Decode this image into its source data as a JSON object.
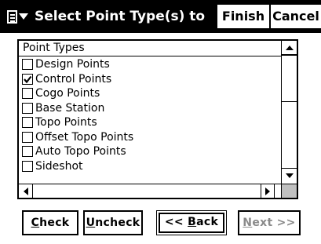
{
  "window": {
    "title": "Select Point Type(s) to Exp",
    "menu_icon": "document-menu-icon"
  },
  "titlebar_buttons": {
    "finish": "Finish",
    "cancel": "Cancel"
  },
  "list": {
    "header": "Point Types",
    "items": [
      {
        "label": "Design Points",
        "checked": false
      },
      {
        "label": "Control Points",
        "checked": true
      },
      {
        "label": "Cogo Points",
        "checked": false
      },
      {
        "label": "Base Station",
        "checked": false
      },
      {
        "label": "Topo Points",
        "checked": false
      },
      {
        "label": "Offset Topo Points",
        "checked": false
      },
      {
        "label": "Auto Topo Points",
        "checked": false
      },
      {
        "label": "Sideshot",
        "checked": false
      }
    ]
  },
  "buttons": {
    "check": {
      "mnemonic": "C",
      "rest": "heck"
    },
    "uncheck": {
      "mnemonic": "U",
      "rest": "ncheck"
    },
    "back": {
      "prefix": "<< ",
      "mnemonic": "B",
      "rest": "ack"
    },
    "next": {
      "mnemonic": "N",
      "rest": "ext >>",
      "enabled": false
    }
  }
}
